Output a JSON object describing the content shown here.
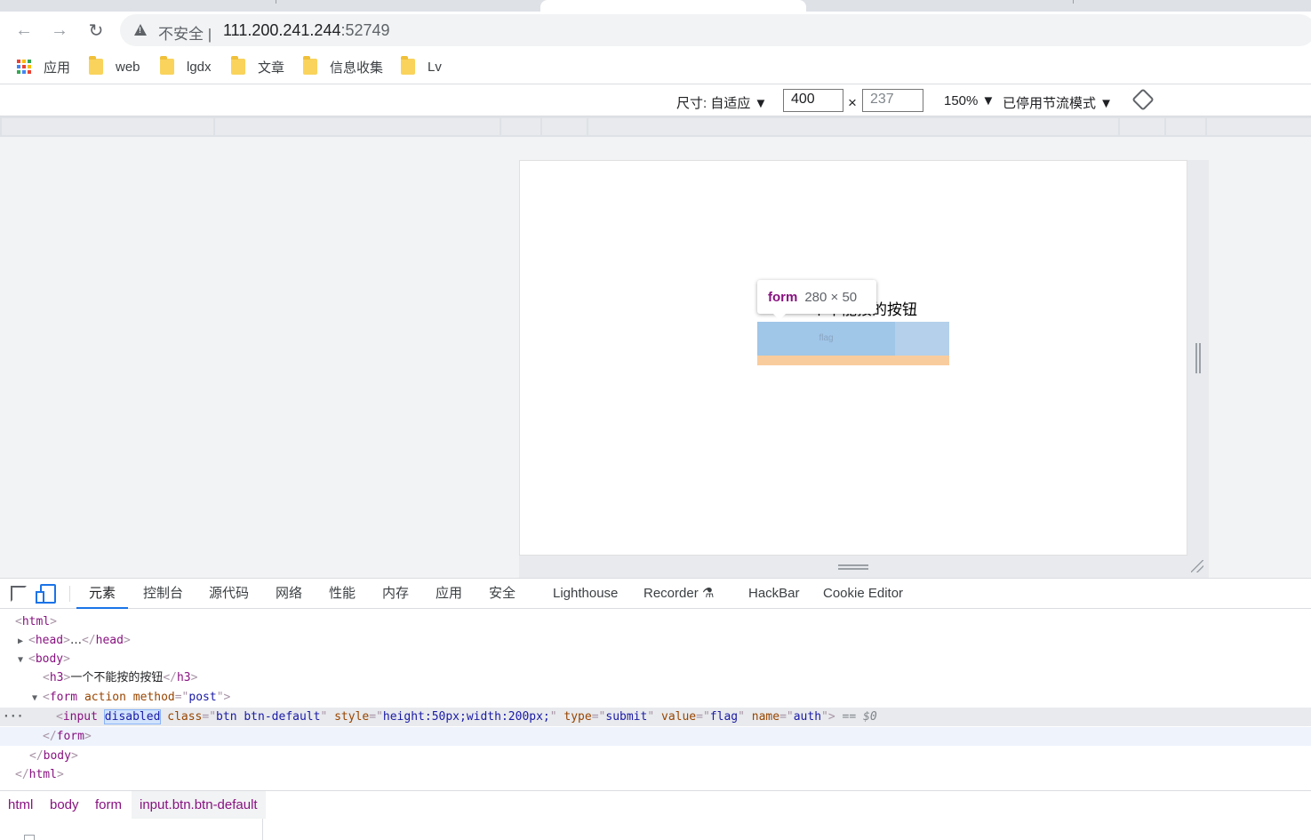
{
  "browser": {
    "security_label": "不安全",
    "separator": "|",
    "url_host": "111.200.241.244",
    "url_port": ":52749",
    "back_icon": "←",
    "forward_icon": "→",
    "reload_icon": "↻"
  },
  "bookmarks": [
    {
      "label": "应用",
      "icon": "apps-grid-icon"
    },
    {
      "label": "web",
      "icon": "folder-icon"
    },
    {
      "label": "lgdx",
      "icon": "folder-icon"
    },
    {
      "label": "文章",
      "icon": "folder-icon"
    },
    {
      "label": "信息收集",
      "icon": "folder-icon"
    },
    {
      "label": "Lv",
      "icon": "folder-icon"
    }
  ],
  "device_toolbar": {
    "dimensions_label": "尺寸: 自适应 ▼",
    "width": "400",
    "times": "×",
    "height": "237",
    "zoom": "150% ▼",
    "throttle": "已停用节流模式 ▼"
  },
  "page": {
    "h3_text": "一个不能按的按钮",
    "button_value": "flag",
    "tooltip_tag": "form",
    "tooltip_size": "280 × 50"
  },
  "devtools": {
    "tabs": [
      "元素",
      "控制台",
      "源代码",
      "网络",
      "性能",
      "内存",
      "应用",
      "安全",
      "Lighthouse",
      "Recorder ⚗",
      "HackBar",
      "Cookie Editor"
    ],
    "active_tab": "元素"
  },
  "dom_lines": {
    "html_open": "html",
    "head": "head",
    "head_ellipsis": "…",
    "body_open": "body",
    "h3_tag": "h3",
    "h3_text": "一个不能按的按钮",
    "form_tag": "form",
    "form_attr_action": "action",
    "form_attr_method": "method",
    "form_method_val": "post",
    "input_tag": "input",
    "input_disabled": "disabled",
    "input_class_attr": "class",
    "input_class_val": "btn btn-default",
    "input_style_attr": "style",
    "input_style_val": "height:50px;width:200px;",
    "input_type_attr": "type",
    "input_type_val": "submit",
    "input_value_attr": "value",
    "input_value_val": "flag",
    "input_name_attr": "name",
    "input_name_val": "auth",
    "selected_marker": "== $0",
    "row_menu": "···"
  },
  "breadcrumbs": [
    "html",
    "body",
    "form",
    "input.btn.btn-default"
  ],
  "colors": {
    "tag": "#881280",
    "attr": "#994500",
    "value": "#1a1aa6",
    "accent": "#1a73e8"
  }
}
